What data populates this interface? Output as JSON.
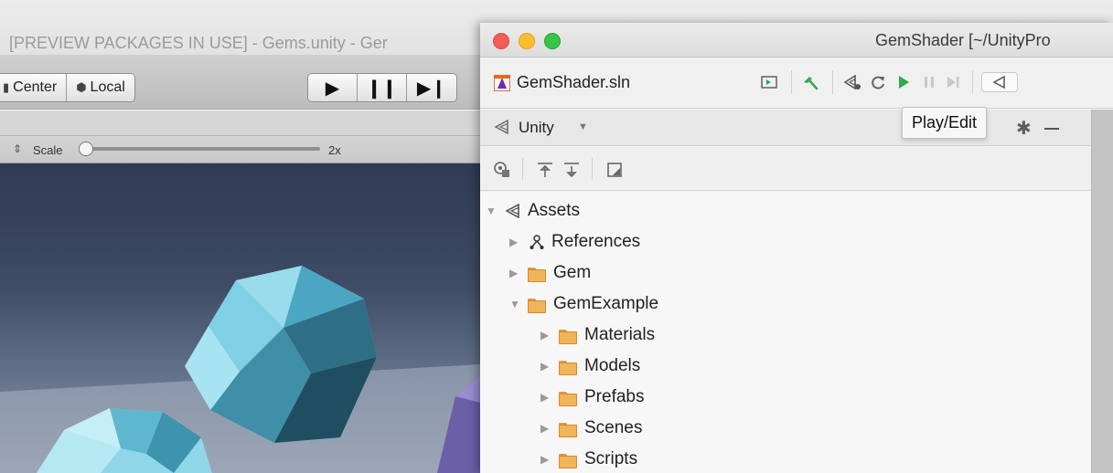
{
  "unity_editor": {
    "title": "[PREVIEW PACKAGES IN USE] - Gems.unity - Ger",
    "pivot_buttons": {
      "center_label": "Center",
      "local_label": "Local"
    },
    "scene_bar": {
      "scale_label": "Scale",
      "scale_value": "2x",
      "scale_level": 0.0
    }
  },
  "rider": {
    "window_title": "GemShader [~/UnityPro",
    "solution_name": "GemShader.sln",
    "tooltip": "Play/Edit",
    "panel": {
      "title": "Unity"
    },
    "tree": {
      "root": "Assets",
      "items": [
        {
          "label": "References",
          "expanded": false,
          "icon": "references-icon"
        },
        {
          "label": "Gem",
          "expanded": false,
          "icon": "folder-icon"
        },
        {
          "label": "GemExample",
          "expanded": true,
          "icon": "folder-icon"
        }
      ],
      "children": [
        {
          "label": "Materials"
        },
        {
          "label": "Models"
        },
        {
          "label": "Prefabs"
        },
        {
          "label": "Scenes"
        },
        {
          "label": "Scripts"
        }
      ]
    },
    "colors": {
      "play_green": "#2fa84f",
      "build_green": "#3aa655",
      "folder": "#f0b45a"
    }
  }
}
